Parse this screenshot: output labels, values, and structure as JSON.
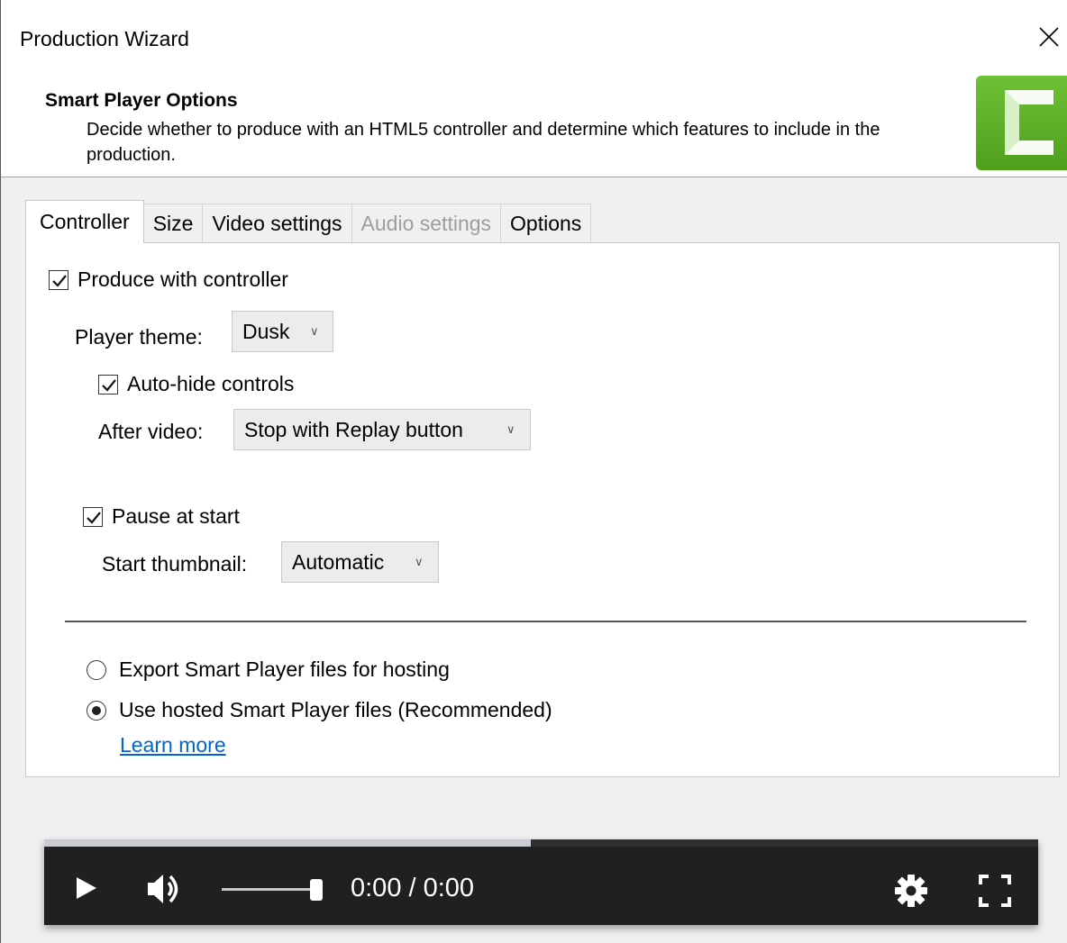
{
  "window": {
    "title": "Production Wizard"
  },
  "header": {
    "title": "Smart Player Options",
    "description": "Decide whether to produce with an HTML5 controller and determine which features to include in the production."
  },
  "tabs": [
    {
      "label": "Controller",
      "active": true,
      "enabled": true
    },
    {
      "label": "Size",
      "active": false,
      "enabled": true
    },
    {
      "label": "Video settings",
      "active": false,
      "enabled": true
    },
    {
      "label": "Audio settings",
      "active": false,
      "enabled": false
    },
    {
      "label": "Options",
      "active": false,
      "enabled": true
    }
  ],
  "controller": {
    "produce_with_controller": {
      "label": "Produce with controller",
      "checked": true
    },
    "player_theme": {
      "label": "Player theme:",
      "value": "Dusk"
    },
    "auto_hide": {
      "label": "Auto-hide controls",
      "checked": true
    },
    "after_video": {
      "label": "After video:",
      "value": "Stop with Replay button"
    },
    "pause_at_start": {
      "label": "Pause at start",
      "checked": true
    },
    "start_thumbnail": {
      "label": "Start thumbnail:",
      "value": "Automatic"
    },
    "hosting": {
      "export_option": "Export Smart Player files for hosting",
      "hosted_option": "Use hosted Smart Player files (Recommended)",
      "selected": "hosted"
    },
    "learn_more": "Learn more"
  },
  "player": {
    "time": "0:00 / 0:00",
    "progress": 0.49,
    "volume": 0.95
  },
  "colors": {
    "logo_green": "#5aae26",
    "link": "#0066cc",
    "player_bg": "#1f2021"
  }
}
